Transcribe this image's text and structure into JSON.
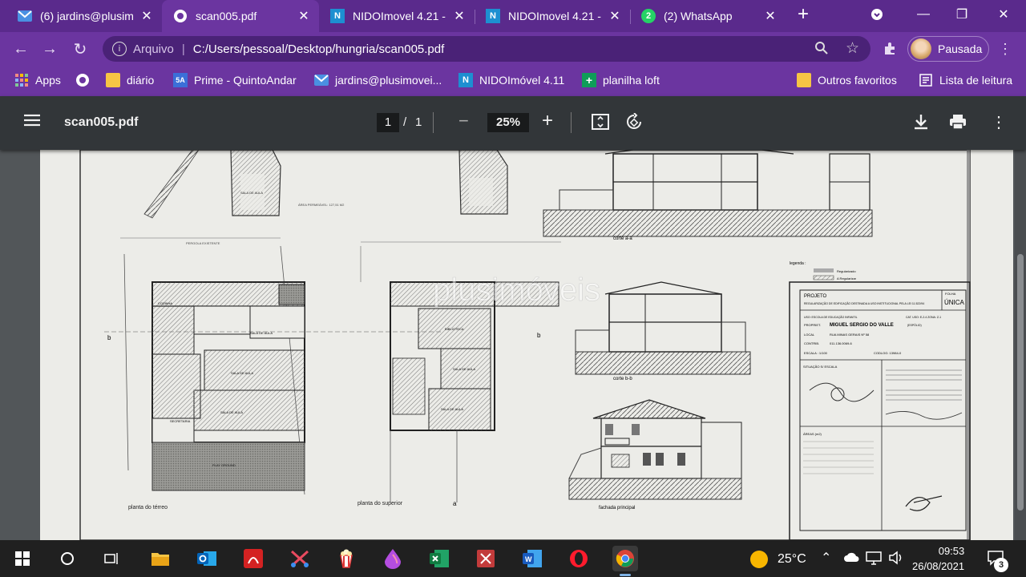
{
  "tabs": [
    {
      "title": "(6) jardins@plusim",
      "icon": "mail-icon"
    },
    {
      "title": "scan005.pdf",
      "icon": "globe-icon"
    },
    {
      "title": "NIDOImovel 4.21 -",
      "icon": "nido-icon"
    },
    {
      "title": "NIDOImovel 4.21 -",
      "icon": "nido-icon"
    },
    {
      "title": "(2) WhatsApp",
      "icon": "whatsapp-icon",
      "badge": "2"
    }
  ],
  "address": {
    "scheme_label": "Arquivo",
    "url": "C:/Users/pessoal/Desktop/hungria/scan005.pdf"
  },
  "profile": {
    "label": "Pausada"
  },
  "bookmarks": {
    "items": [
      {
        "label": "Apps"
      },
      {
        "label": "diário"
      },
      {
        "label": "Prime - QuintoAndar",
        "icon_text": "5A"
      },
      {
        "label": "jardins@plusimovei..."
      },
      {
        "label": "NIDOImóvel 4.11"
      },
      {
        "label": "planilha loft"
      }
    ],
    "others": "Outros favoritos",
    "reading_list": "Lista de leitura"
  },
  "pdf": {
    "filename": "scan005.pdf",
    "current_page": "1",
    "separator": "/",
    "total_pages": "1",
    "zoom": "25%"
  },
  "drawing": {
    "labels": {
      "planta_terreo": "planta do térreo",
      "planta_superior": "planta do superior",
      "corte_aa": "corte a-a",
      "corte_bb": "corte b-b",
      "fachada": "fachada principal",
      "legenda": "legenda :",
      "regularizado": "Regularizado",
      "a_regularizar": "A Regularizar",
      "projeto": "PROJETO",
      "folha": "FOLHA",
      "unica": "ÚNICA",
      "desc": "REGULARIZAÇÃO DE EDIFICAÇÃO DESTINADA A USO INSTITUCIONAL PELA LEI 11.522/94",
      "uso": "USO: ESCOLA DE EDUCAÇÃO INFANTIL",
      "cat_uso": "CAT. USO: E-2.4  ZONA: Z-1",
      "proprietario_label": "PROPRIET.",
      "proprietario": "MIGUEL SERGIO DO VALLE",
      "espolio": "(ESPÓLIO)",
      "local_label": "LOCAL",
      "local": "RUA MINAS GERAIS Nº 58",
      "contrib": "CONTRIB.",
      "contrib_value": "011.136.0069-6",
      "escala": "ESCALA : 1/100",
      "codlog": "CODLOG: 13984-0",
      "situacao": "SITUAÇÃO S/ ESCALA",
      "areas": "ÁREAS (m2)",
      "watermark": "plusimóveis",
      "sala_de_aula": "SALA DE AULA",
      "biblioteca": "BIBLIOTECA",
      "secretaria": "SECRETARIA",
      "play_ground": "PLAY GROUND",
      "cozinha": "COZINHA",
      "area_permeavel": "ÁREA PERMEÁVEL: 127,51 M2",
      "pergola": "PERGOLA EXISTENTE",
      "b": "b",
      "a": "a"
    }
  },
  "taskbar": {
    "weather": "25°C",
    "time": "09:53",
    "date": "26/08/2021",
    "notifications": "3"
  },
  "colors": {
    "tabstrip": "#5a2a8c",
    "toolbar": "#6b35a0",
    "pdf_bar": "#323639",
    "pdf_bg": "#525659",
    "taskbar": "#202020"
  }
}
